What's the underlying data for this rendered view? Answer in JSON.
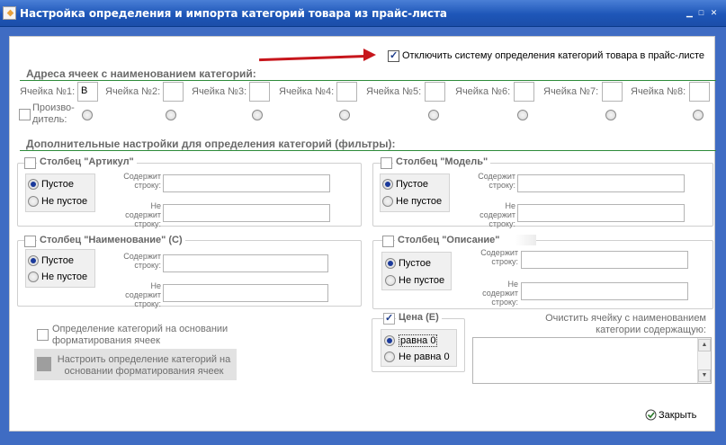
{
  "window": {
    "title": "Настройка определения и импорта категорий товара из прайс-листа"
  },
  "disable_option": {
    "label": "Отключить систему определения категорий товара в прайс-листе",
    "checked": true
  },
  "cell_addresses": {
    "title": "Адреса ячеек с наименованием категорий:",
    "cells": [
      {
        "label": "Ячейка №1:",
        "value": "B"
      },
      {
        "label": "Ячейка №2:",
        "value": ""
      },
      {
        "label": "Ячейка №3:",
        "value": ""
      },
      {
        "label": "Ячейка №4:",
        "value": ""
      },
      {
        "label": "Ячейка №5:",
        "value": ""
      },
      {
        "label": "Ячейка №6:",
        "value": ""
      },
      {
        "label": "Ячейка №7:",
        "value": ""
      },
      {
        "label": "Ячейка №8:",
        "value": ""
      }
    ],
    "manufacturer_label_line1": "Произво-",
    "manufacturer_label_line2": "дитель:"
  },
  "filters": {
    "title": "Дополнительные настройки для определения категорий (фильтры):",
    "contains_label_1": "Содержит",
    "contains_label_2": "строку:",
    "not_contains_label_1": "Не",
    "not_contains_label_2": "содержит",
    "not_contains_label_3": "строку:",
    "empty_label": "Пустое",
    "not_empty_label": "Не пустое",
    "groups": [
      {
        "name": "Столбец \"Артикул\""
      },
      {
        "name": "Столбец \"Модель\""
      },
      {
        "name": "Столбец \"Наименование\" (C)"
      },
      {
        "name": "Столбец \"Описание\""
      }
    ]
  },
  "formatting": {
    "checkbox_label_1": "Определение категорий на основании",
    "checkbox_label_2": "форматирования ячеек",
    "button_label_1": "Настроить определение категорий на",
    "button_label_2": "основании форматирования ячеек"
  },
  "price": {
    "title": "Цена (E)",
    "equal_zero": "равна 0",
    "not_equal_zero": "Не равна 0"
  },
  "clear": {
    "label_1": "Очистить ячейку с наименованием",
    "label_2": "категории содержащую:",
    "value": ""
  },
  "close_label": "Закрыть",
  "colors": {
    "title_bar": "#1e56b8",
    "frame": "#3f6cc3",
    "section_line": "#2e8b3a",
    "arrow": "#c7161c"
  }
}
